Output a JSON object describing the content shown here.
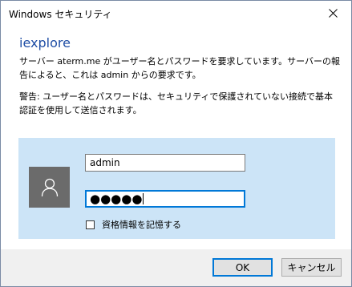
{
  "window": {
    "title": "Windows セキュリティ",
    "close_icon": "close-icon"
  },
  "dialog": {
    "heading": "iexplore",
    "message": "サーバー aterm.me がユーザー名とパスワードを要求しています。サーバーの報告によると、これは admin からの要求です。",
    "warning": "警告: ユーザー名とパスワードは、セキュリティで保護されていない接続で基本認証を使用して送信されます。",
    "accent_color": "#1f4ea5"
  },
  "credentials": {
    "avatar_icon": "user-icon",
    "username_value": "admin",
    "password_mask": "●●●●●",
    "remember_checked": false,
    "remember_label": "資格情報を記憶する",
    "panel_color": "#cce4f7"
  },
  "buttons": {
    "ok_label": "OK",
    "cancel_label": "キャンセル"
  }
}
